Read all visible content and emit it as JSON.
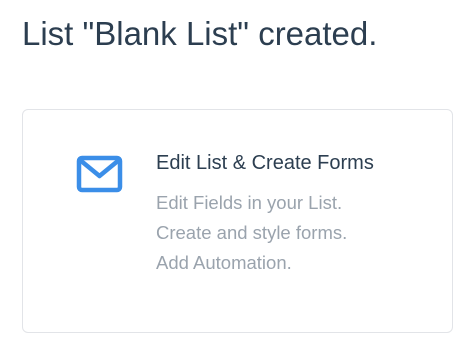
{
  "header": {
    "title": "List \"Blank List\" created."
  },
  "card": {
    "icon": "envelope-icon",
    "icon_color": "#3b8ee8",
    "heading": "Edit List & Create Forms",
    "lines": [
      "Edit Fields in your List.",
      "Create and style forms.",
      "Add Automation."
    ]
  }
}
